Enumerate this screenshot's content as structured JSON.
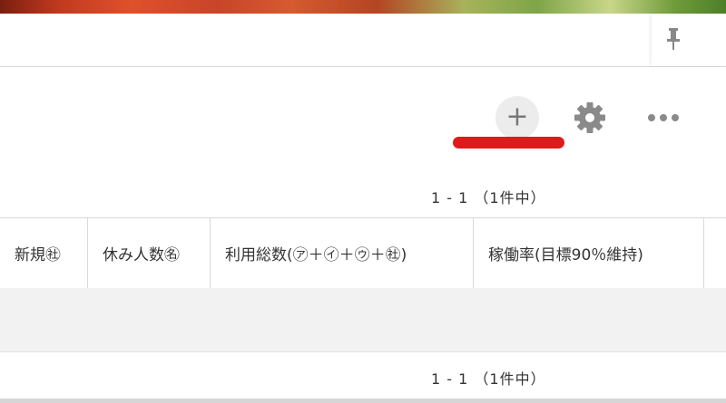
{
  "toolbar": {
    "add_label": "+",
    "add_icon": "plus-icon",
    "settings_icon": "gear-icon",
    "more_icon": "more-horizontal-icon",
    "pin_icon": "pin-icon",
    "highlight_color": "#e01a1a"
  },
  "pager_top": {
    "text": "1 - 1 （1件中）"
  },
  "table": {
    "columns": [
      {
        "label": "新規㊓"
      },
      {
        "label": "休み人数㊔"
      },
      {
        "label": "利用総数(㋐＋㋑＋㋒＋㊓)"
      },
      {
        "label": "稼働率(目標90％維持)"
      }
    ]
  },
  "pager_bottom": {
    "text": "1 - 1 （1件中）"
  }
}
